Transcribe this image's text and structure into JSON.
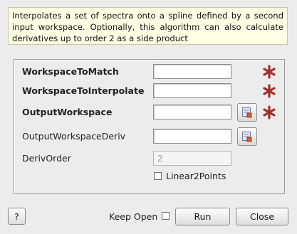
{
  "description": "Interpolates a set of spectra onto a spline defined by a second input workspace. Optionally, this algorithm can also calculate derivatives up to order 2 as a side product",
  "fields": [
    {
      "label": "WorkspaceToMatch",
      "value": ""
    },
    {
      "label": "WorkspaceToInterpolate",
      "value": ""
    },
    {
      "label": "OutputWorkspace",
      "value": ""
    },
    {
      "label": "OutputWorkspaceDeriv",
      "value": ""
    },
    {
      "label": "DerivOrder",
      "value": "2"
    }
  ],
  "linear2points": {
    "label": "Linear2Points",
    "checked": false
  },
  "footer": {
    "help_label": "?",
    "keep_open_label": "Keep Open",
    "keep_open_checked": false,
    "run_label": "Run",
    "close_label": "Close"
  },
  "icons": {
    "required": "required-star-icon",
    "browse": "workspace-browse-icon"
  },
  "colors": {
    "description_bg": "#ffffe4",
    "required_star": "#a0312a"
  }
}
